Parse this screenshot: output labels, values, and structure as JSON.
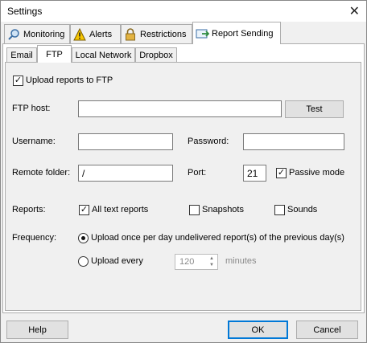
{
  "window": {
    "title": "Settings"
  },
  "top_tabs": [
    {
      "label": "Monitoring",
      "icon": "magnifier-icon"
    },
    {
      "label": "Alerts",
      "icon": "warning-icon"
    },
    {
      "label": "Restrictions",
      "icon": "padlock-icon"
    },
    {
      "label": "Report Sending",
      "icon": "report-send-icon"
    }
  ],
  "inner_tabs": [
    "Email",
    "FTP",
    "Local Network",
    "Dropbox"
  ],
  "ftp": {
    "upload_label": "Upload reports to FTP",
    "upload_checked": true,
    "host_label": "FTP host:",
    "host_value": "",
    "test_label": "Test",
    "username_label": "Username:",
    "username_value": "",
    "password_label": "Password:",
    "password_value": "",
    "remote_folder_label": "Remote folder:",
    "remote_folder_value": "/",
    "port_label": "Port:",
    "port_value": "21",
    "passive_label": "Passive mode",
    "passive_checked": true,
    "reports_label": "Reports:",
    "reports_options": [
      {
        "label": "All text reports",
        "checked": true
      },
      {
        "label": "Snapshots",
        "checked": false
      },
      {
        "label": "Sounds",
        "checked": false
      }
    ],
    "frequency_label": "Frequency:",
    "freq_option1": "Upload once per day undelivered report(s) of the previous day(s)",
    "freq_option2": "Upload every",
    "interval_value": "120",
    "interval_unit": "minutes"
  },
  "buttons": {
    "help": "Help",
    "ok": "OK",
    "cancel": "Cancel"
  },
  "colors": {
    "accent": "#0078d7",
    "panel_bg": "#f0f0f0",
    "tab_active_bg": "#ffffff"
  }
}
